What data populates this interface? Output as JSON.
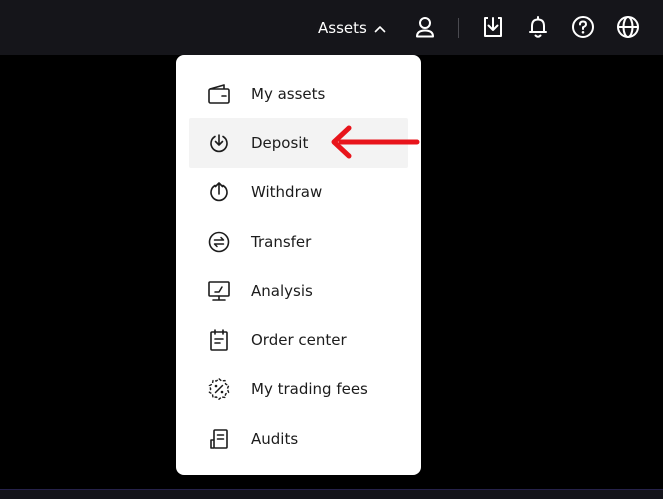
{
  "topbar": {
    "assets_label": "Assets",
    "icons": [
      "user-icon",
      "download-app-icon",
      "bell-icon",
      "help-icon",
      "globe-icon"
    ]
  },
  "menu": {
    "items": [
      {
        "label": "My assets",
        "icon": "wallet-icon"
      },
      {
        "label": "Deposit",
        "icon": "deposit-icon"
      },
      {
        "label": "Withdraw",
        "icon": "withdraw-icon"
      },
      {
        "label": "Transfer",
        "icon": "transfer-icon"
      },
      {
        "label": "Analysis",
        "icon": "analysis-icon"
      },
      {
        "label": "Order center",
        "icon": "order-center-icon"
      },
      {
        "label": "My trading fees",
        "icon": "trading-fees-icon"
      },
      {
        "label": "Audits",
        "icon": "audits-icon"
      }
    ],
    "highlighted_item": "Deposit"
  },
  "annotation": {
    "type": "arrow",
    "color": "#e8141b",
    "points_to": "Deposit"
  },
  "colors": {
    "background": "#000000",
    "topbar": "#15151a",
    "menu_background": "#ffffff",
    "highlight_background": "#f3f3f3",
    "text": "#1c1c1c",
    "annotation": "#e8141b"
  }
}
